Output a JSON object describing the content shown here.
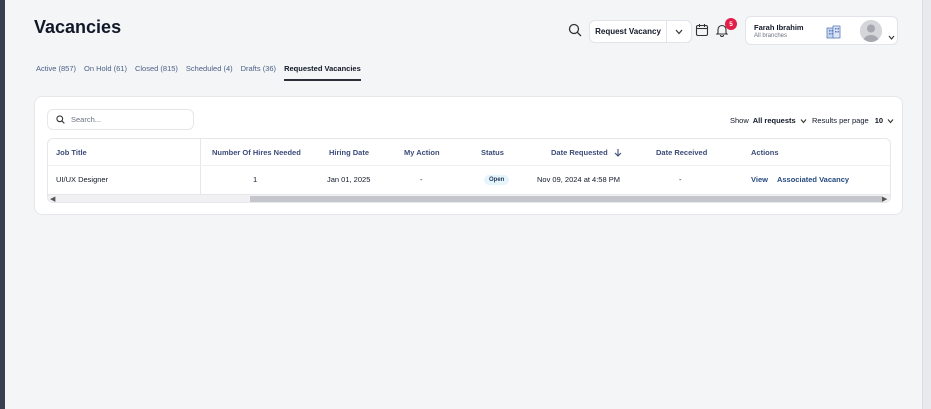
{
  "page": {
    "title": "Vacancies"
  },
  "header": {
    "request_vacancy_label": "Request Vacancy",
    "notification_count": "5",
    "user": {
      "name": "Farah Ibrahim",
      "scope": "All branches"
    }
  },
  "tabs": [
    {
      "label": "Active (857)",
      "active": false
    },
    {
      "label": "On Hold (61)",
      "active": false
    },
    {
      "label": "Closed (815)",
      "active": false
    },
    {
      "label": "Scheduled (4)",
      "active": false
    },
    {
      "label": "Drafts (36)",
      "active": false
    },
    {
      "label": "Requested Vacancies",
      "active": true
    }
  ],
  "filters": {
    "search_placeholder": "Search...",
    "show_label": "Show",
    "show_value": "All requests",
    "rpp_label": "Results per page",
    "rpp_value": "10"
  },
  "table": {
    "columns": [
      "Job Title",
      "Number Of Hires Needed",
      "Hiring Date",
      "My Action",
      "Status",
      "Date Requested",
      "Date Received",
      "Actions"
    ],
    "rows": [
      {
        "job_title": "UI/UX Designer",
        "hires": "1",
        "hiring_date": "Jan 01, 2025",
        "my_action": "-",
        "status": "Open",
        "date_requested": "Nov 09, 2024 at 4:58 PM",
        "date_received": "-",
        "actions": [
          "View",
          "Associated Vacancy"
        ]
      }
    ]
  },
  "colors": {
    "accent": "#274a7e",
    "badge": "#e11d48",
    "status_bg": "#e6f4fb"
  }
}
